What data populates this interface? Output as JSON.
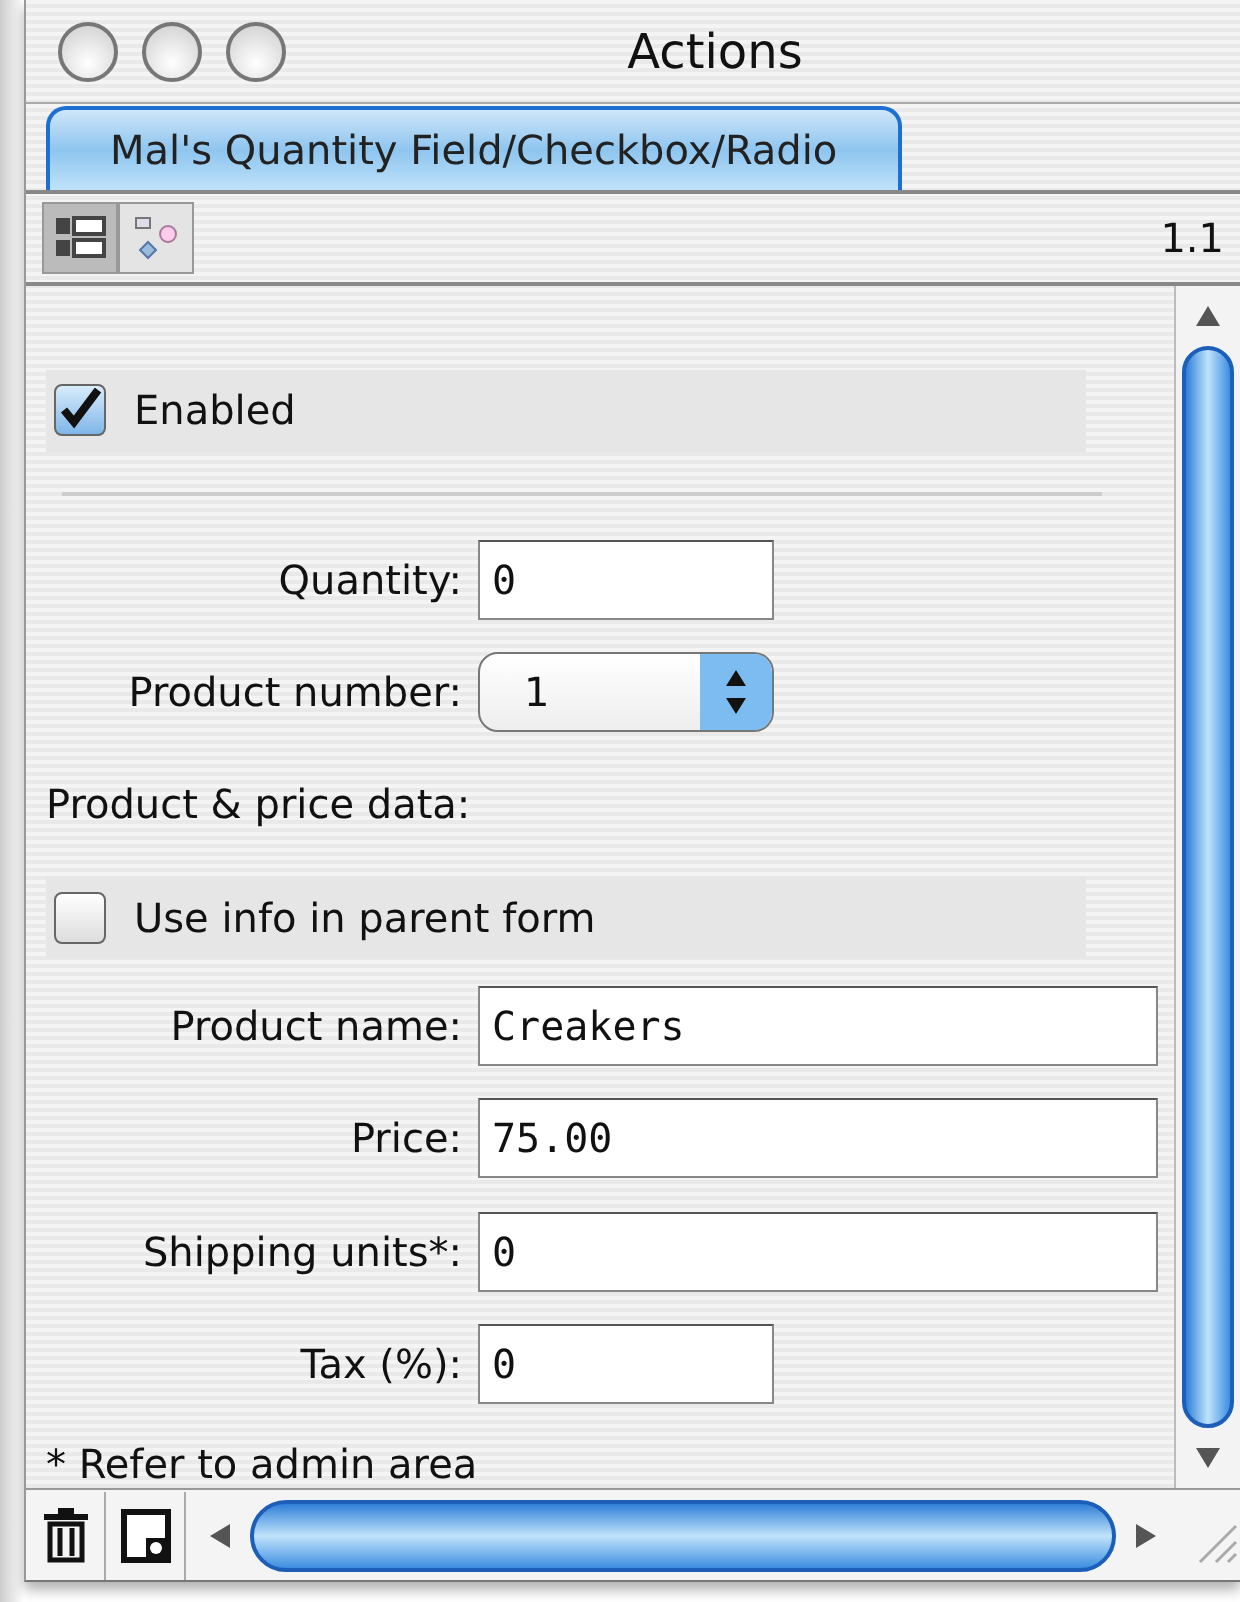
{
  "window": {
    "title": "Actions"
  },
  "tabs": [
    {
      "label": "Mal's Quantity Field/Checkbox/Radio",
      "selected": true
    }
  ],
  "toolbar": {
    "views": [
      {
        "kind": "list",
        "selected": true
      },
      {
        "kind": "diagram",
        "selected": false
      }
    ],
    "version": "1.1"
  },
  "form": [
    {
      "kind": "checkbox",
      "label": "Enabled",
      "checked": true
    },
    {
      "kind": "divider"
    },
    {
      "kind": "short-field",
      "label": "Quantity:",
      "value": "0"
    },
    {
      "kind": "stepper",
      "label": "Product number:",
      "value": "1"
    },
    {
      "kind": "heading",
      "label": "Product & price data:"
    },
    {
      "kind": "checkbox",
      "label": "Use info in parent form",
      "checked": false
    },
    {
      "kind": "field",
      "label": "Product name:",
      "value": "Creakers"
    },
    {
      "kind": "field",
      "label": "Price:",
      "value": "75.00"
    },
    {
      "kind": "field",
      "label": "Shipping units*:",
      "value": "0"
    },
    {
      "kind": "short-field",
      "label": "Tax (%):",
      "value": "0"
    },
    {
      "kind": "note",
      "label": "* Refer to admin area"
    }
  ]
}
